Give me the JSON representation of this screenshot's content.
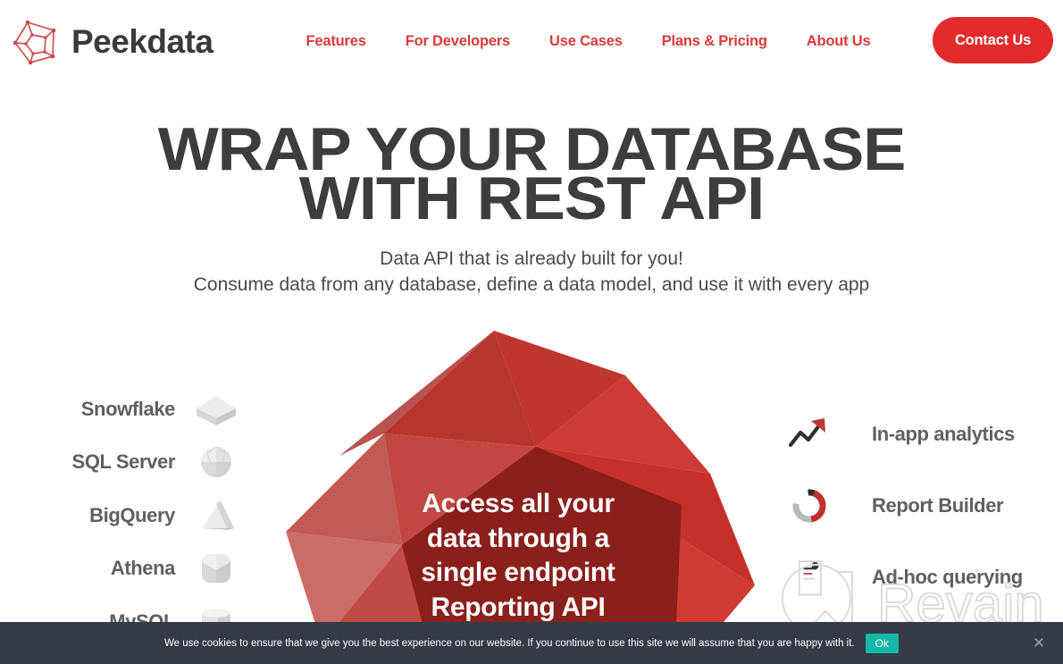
{
  "header": {
    "brand_name": "Peekdata",
    "logo_icon": "peekdata-polygon-logo-icon",
    "nav": [
      {
        "label": "Features"
      },
      {
        "label": "For Developers"
      },
      {
        "label": "Use Cases"
      },
      {
        "label": "Plans & Pricing"
      },
      {
        "label": "About Us"
      }
    ],
    "contact_label": "Contact Us"
  },
  "hero": {
    "title_line1": "WRAP YOUR DATABASE",
    "title_line2": "WITH REST API",
    "subtitle1": "Data API that is already built for you!",
    "subtitle2": "Consume data from any database, define a data model, and use it with every app"
  },
  "gem": {
    "text_line1": "Access all your",
    "text_line2": "data through a",
    "text_line3": "single endpoint",
    "text_line4": "Reporting API"
  },
  "sources": [
    {
      "label": "Snowflake",
      "icon": "cube-diamond-icon"
    },
    {
      "label": "SQL Server",
      "icon": "faceted-sphere-icon"
    },
    {
      "label": "BigQuery",
      "icon": "pyramid-icon"
    },
    {
      "label": "Athena",
      "icon": "rounded-polyhedron-icon"
    },
    {
      "label": "MySQL",
      "icon": "cylinder-database-icon"
    }
  ],
  "features": [
    {
      "label": "In-app analytics",
      "icon": "trend-arrow-icon"
    },
    {
      "label": "Report Builder",
      "icon": "donut-chart-icon"
    },
    {
      "label": "Ad-hoc querying",
      "icon": "magnifier-document-icon"
    }
  ],
  "watermark": {
    "text": "Revain"
  },
  "cookie": {
    "message": "We use cookies to ensure that we give you the best experience on our website. If you continue to use this site we will assume that you are happy with it.",
    "ok_label": "Ok",
    "close_icon": "close-icon"
  },
  "colors": {
    "brand_red": "#e32b2b",
    "nav_red": "#dc3a3a",
    "heading_dark": "#3d3d3d",
    "body_gray": "#4a4a4a",
    "label_gray": "#5f6063",
    "cookie_bg": "#343a46",
    "cookie_ok": "#14b8a6",
    "gem_red": "#c0352f"
  }
}
